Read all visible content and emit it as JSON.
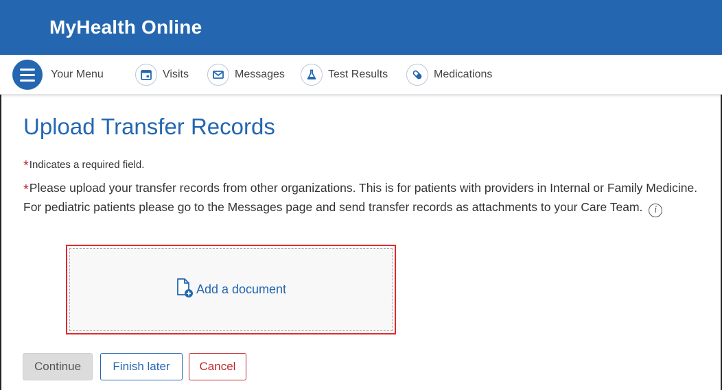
{
  "header": {
    "brand": "MyHealth Online"
  },
  "nav": {
    "menu_label": "Your Menu",
    "items": [
      {
        "label": "Visits",
        "icon": "calendar-icon"
      },
      {
        "label": "Messages",
        "icon": "envelope-icon"
      },
      {
        "label": "Test Results",
        "icon": "flask-icon"
      },
      {
        "label": "Medications",
        "icon": "pill-icon"
      }
    ]
  },
  "page": {
    "title": "Upload Transfer Records",
    "required_asterisk": "*",
    "required_note": "Indicates a required field.",
    "instructions": "Please upload your transfer records from other organizations. This is for patients with providers in Internal or Family Medicine. For pediatric patients please go to the Messages page and send transfer records as attachments to your Care Team.",
    "info_glyph": "i"
  },
  "upload": {
    "label": "Add a document",
    "icon": "add-document-icon"
  },
  "buttons": {
    "continue": "Continue",
    "finish_later": "Finish later",
    "cancel": "Cancel"
  },
  "colors": {
    "brand_blue": "#2467b0",
    "required_red": "#c0272d",
    "highlight_red": "#e3282a"
  }
}
